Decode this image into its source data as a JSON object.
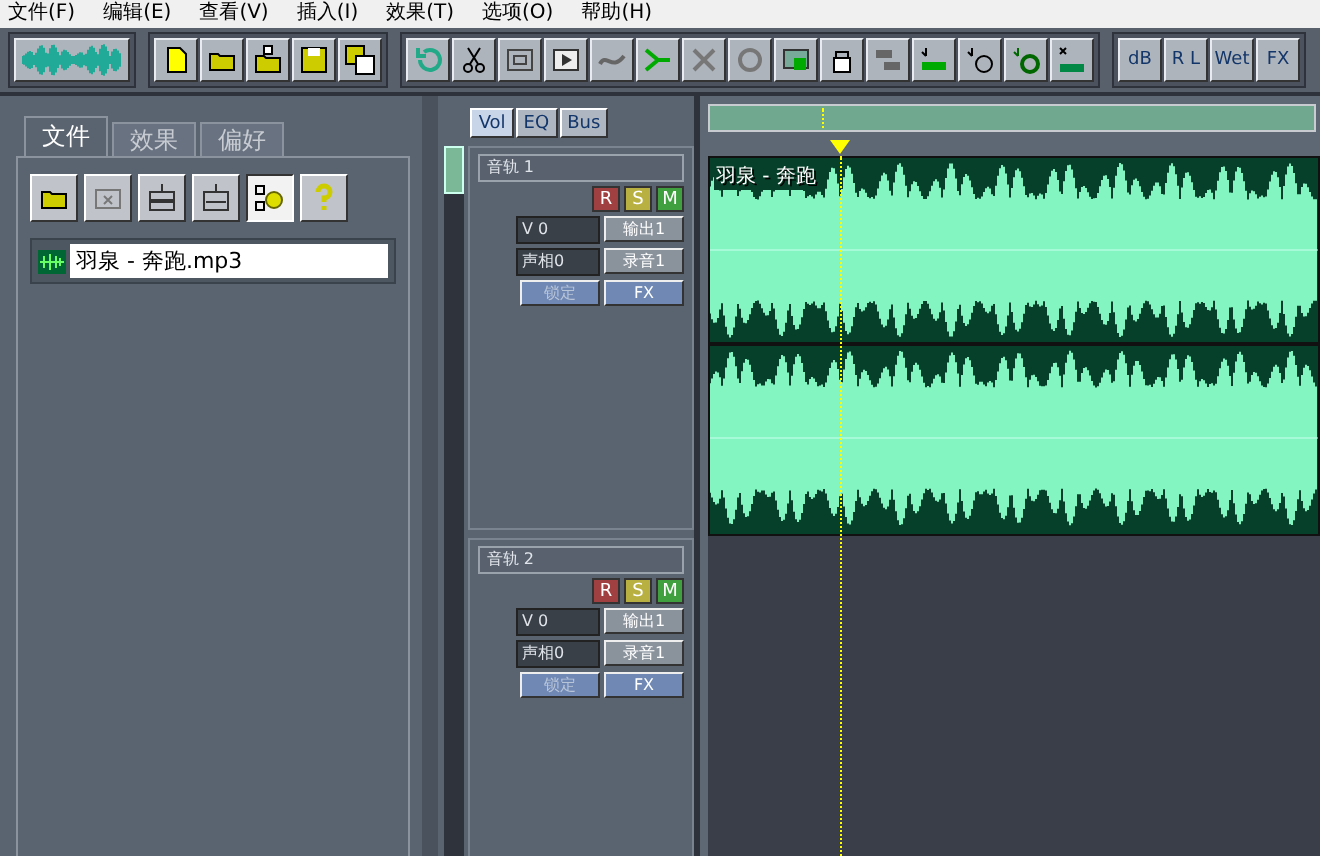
{
  "menu": [
    "文件(F)",
    "编辑(E)",
    "查看(V)",
    "插入(I)",
    "效果(T)",
    "选项(O)",
    "帮助(H)"
  ],
  "toolbar": {
    "text_buttons": [
      {
        "label": "dB"
      },
      {
        "label": "R L"
      },
      {
        "label": "Wet"
      },
      {
        "label": "FX"
      }
    ]
  },
  "organizer": {
    "tabs": [
      {
        "label": "文件",
        "selected": true
      },
      {
        "label": "效果",
        "selected": false
      },
      {
        "label": "偏好",
        "selected": false
      }
    ],
    "files": [
      {
        "name": "羽泉 - 奔跑.mp3",
        "selected": true
      }
    ]
  },
  "mixer_tabs": [
    {
      "label": "Vol",
      "selected": true
    },
    {
      "label": "EQ",
      "selected": false
    },
    {
      "label": "Bus",
      "selected": false
    }
  ],
  "tracks": [
    {
      "name": "音轨 1",
      "volume": "V 0",
      "pan": "声相0",
      "output": "输出1",
      "input": "录音1",
      "lock": "锁定",
      "fx": "FX",
      "record": "R",
      "solo": "S",
      "mute": "M",
      "clip": {
        "title": "羽泉 - 奔跑"
      }
    },
    {
      "name": "音轨 2",
      "volume": "V 0",
      "pan": "声相0",
      "output": "输出1",
      "input": "录音1",
      "lock": "锁定",
      "fx": "FX",
      "record": "R",
      "solo": "S",
      "mute": "M"
    }
  ]
}
